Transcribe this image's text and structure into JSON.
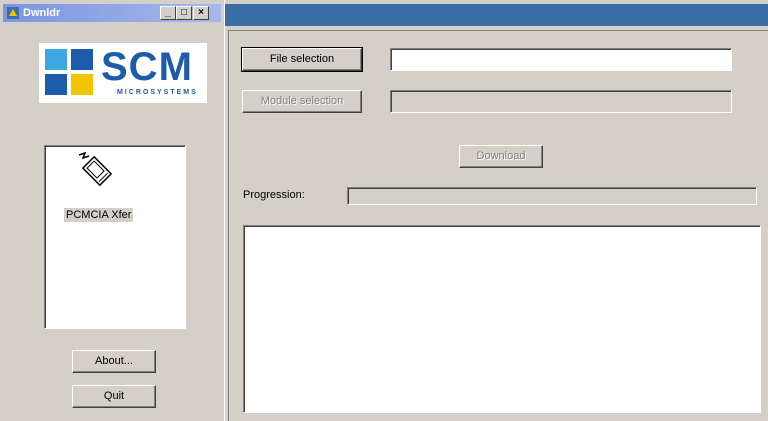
{
  "window": {
    "title": "Dwnldr",
    "controls": {
      "minimize": "_",
      "maximize": "□",
      "close": "×"
    }
  },
  "logo": {
    "brand": "SCM",
    "subtitle": "MICROSYSTEMS",
    "colors": {
      "blue": "#1c5cab",
      "light_blue": "#3ea6e0",
      "yellow": "#f2c500"
    }
  },
  "modules": [
    {
      "label": "PCMCIA Xfer",
      "icon": "pcmcia-card-icon",
      "selected": true
    }
  ],
  "left_buttons": {
    "about": "About...",
    "quit": "Quit"
  },
  "main": {
    "file_selection_button": "File selection",
    "file_selection_value": "",
    "module_selection_button": "Module selection",
    "module_selection_value": "",
    "download_button": "Download",
    "progression_label": "Progression:",
    "progress": 0,
    "log_text": ""
  },
  "colors": {
    "face": "#d4d0c8",
    "title_active": "#3a6ea5",
    "title_inactive": "#7a96df"
  }
}
